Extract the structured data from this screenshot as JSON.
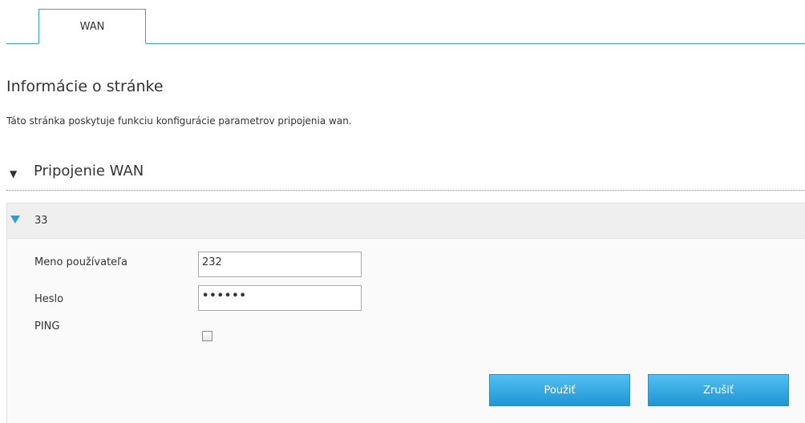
{
  "tabs": [
    {
      "label": "WAN",
      "active": true
    }
  ],
  "page_info": {
    "title": "Informácie o stránke",
    "description": "Táto stránka poskytuje funkciu konfigurácie parametrov pripojenia wan."
  },
  "section": {
    "title": "Pripojenie WAN",
    "arrow": "▼"
  },
  "connection": {
    "name": "33",
    "fields": {
      "username_label": "Meno používateľa",
      "username_value": "232",
      "password_label": "Heslo",
      "password_value": "••••••",
      "ping_label": "PING",
      "ping_checked": false
    },
    "buttons": {
      "apply_label": "Použiť",
      "cancel_label": "Zrušiť"
    }
  },
  "colors": {
    "accent": "#3a9fd8",
    "button": "#1f95d3",
    "arrow": "#2b9fde"
  }
}
